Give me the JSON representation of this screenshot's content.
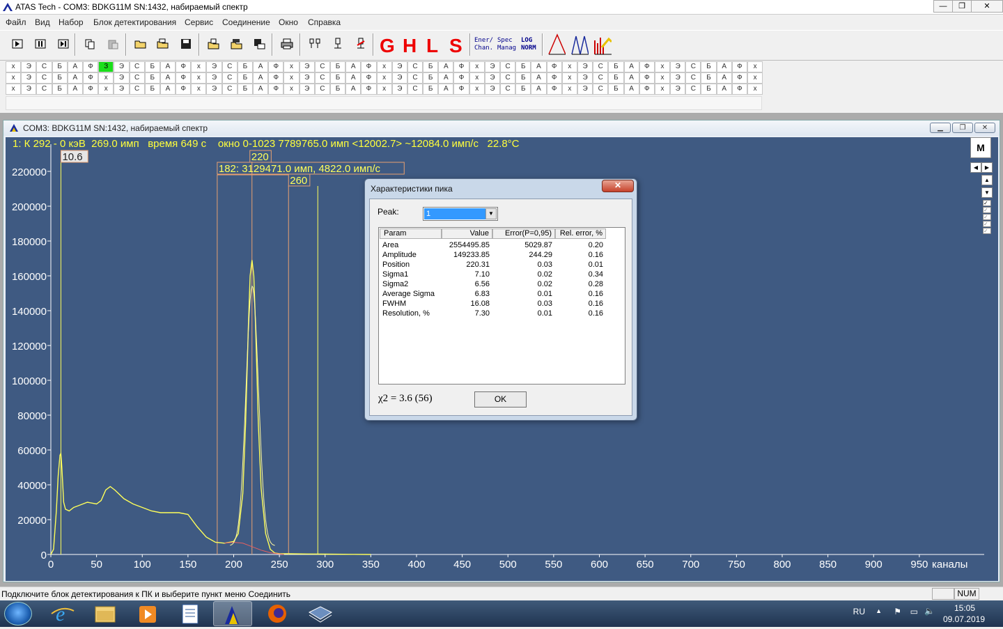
{
  "window": {
    "title": "ATAS Tech  - COM3: BDKG11M SN:1432, набираемый спектр"
  },
  "menu": [
    "Файл",
    "Вид",
    "Набор",
    "Блок детектирования",
    "Сервис",
    "Соединение",
    "Окно",
    "Справка"
  ],
  "toolbar": {
    "big_letters": [
      "G",
      "H",
      "L",
      "S"
    ],
    "ener_chan": [
      "Ener/",
      "Chan."
    ],
    "spec_manag": [
      "Spec",
      "Manag"
    ],
    "log_norm": [
      "LOG",
      "NORM"
    ]
  },
  "grid": {
    "letters": [
      "х",
      "Э",
      "С",
      "Б",
      "А",
      "Ф"
    ],
    "highlight_label": "З"
  },
  "child": {
    "title": "COM3: BDKG11M SN:1432, набираемый спектр",
    "m_button": "M"
  },
  "plot": {
    "status_line": "1: К 292 - 0 кэВ  269.0 имп   время 649 с    окно 0-1023 7789765.0 имп <12002.7> ~12084.0 имп/с   22.8°C",
    "marker_label": "10.6",
    "peak_label": "220",
    "window_label": "182: 3129471.0 имп, 4822.0 имп/с",
    "right_label": "260",
    "x_unit": "каналы",
    "line_color": "#ffff5a",
    "bg_color": "#3f5a82"
  },
  "chart_data": {
    "type": "line",
    "title": "",
    "xlabel": "каналы",
    "ylabel": "",
    "xlim": [
      0,
      1023
    ],
    "ylim": [
      0,
      220000
    ],
    "x_ticks": [
      0,
      50,
      100,
      150,
      200,
      250,
      300,
      350,
      400,
      450,
      500,
      550,
      600,
      650,
      700,
      750,
      800,
      850,
      900,
      950
    ],
    "y_ticks": [
      0,
      20000,
      40000,
      60000,
      80000,
      100000,
      120000,
      140000,
      160000,
      180000,
      200000,
      220000
    ],
    "series": [
      {
        "x": [
          0,
          3,
          6,
          8,
          10,
          11,
          12,
          14,
          16,
          20,
          25,
          30,
          40,
          50,
          55,
          60,
          65,
          70,
          80,
          90,
          100,
          110,
          120,
          130,
          140,
          150,
          160,
          170,
          180,
          190,
          200,
          205,
          210,
          213,
          216,
          218,
          220,
          222,
          224,
          227,
          230,
          235,
          240,
          245,
          250,
          260,
          280,
          300,
          330,
          350
        ],
        "y": [
          0,
          3000,
          25000,
          45000,
          57000,
          58000,
          50000,
          30000,
          26000,
          25000,
          27000,
          28000,
          30000,
          29000,
          31000,
          37000,
          39000,
          37000,
          32000,
          29000,
          27000,
          25000,
          24000,
          24000,
          24000,
          23000,
          16000,
          10000,
          7000,
          6500,
          7500,
          12000,
          35000,
          75000,
          130000,
          160000,
          169000,
          160000,
          130000,
          75000,
          38000,
          12000,
          3000,
          800,
          500,
          400,
          300,
          200,
          100,
          0
        ]
      },
      {
        "x": [
          190,
          200,
          210,
          220,
          230,
          240,
          250,
          255
        ],
        "y": [
          6500,
          7000,
          6500,
          4500,
          2500,
          1000,
          300,
          0
        ]
      }
    ],
    "markers": [
      11,
      182,
      220,
      260,
      292
    ]
  },
  "dialog": {
    "title": "Характеристики пика",
    "peak_label": "Peak:",
    "peak_value": "1",
    "headers": [
      "Param",
      "Value",
      "Error(P=0,95)",
      "Rel. error, %"
    ],
    "rows": [
      [
        "Area",
        "2554495.85",
        "5029.87",
        "0.20"
      ],
      [
        "Amplitude",
        "149233.85",
        "244.29",
        "0.16"
      ],
      [
        "Position",
        "220.31",
        "0.03",
        "0.01"
      ],
      [
        "Sigma1",
        "7.10",
        "0.02",
        "0.34"
      ],
      [
        "Sigma2",
        "6.56",
        "0.02",
        "0.28"
      ],
      [
        "Average Sigma",
        "6.83",
        "0.01",
        "0.16"
      ],
      [
        "FWHM",
        "16.08",
        "0.03",
        "0.16"
      ],
      [
        "Resolution, %",
        "7.30",
        "0.01",
        "0.16"
      ]
    ],
    "chi2": "χ2 = 3.6 (56)",
    "ok": "OK"
  },
  "statusbar": {
    "message": "Подключите блок детектирования к ПК и выберите пункт меню Соединить",
    "num": "NUM"
  },
  "tray": {
    "lang": "RU",
    "time": "15:05",
    "date": "09.07.2019"
  }
}
